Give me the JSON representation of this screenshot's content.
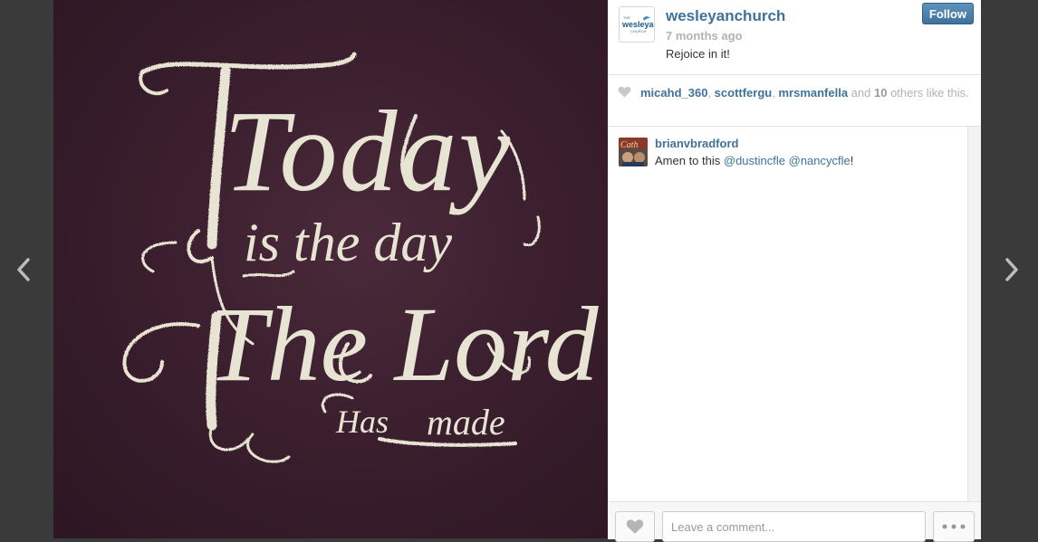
{
  "navigation": {
    "prev_icon": "chevron-left-icon",
    "next_icon": "chevron-right-icon"
  },
  "photo": {
    "lines": [
      "Today",
      "is the day",
      "The Lord",
      "Has",
      "made"
    ],
    "background_color": "#3b1f2e",
    "chalk_color": "#e8e4d4"
  },
  "post": {
    "owner_avatar_text": "wesleyan",
    "owner_avatar_small_top": "THE",
    "owner_avatar_small_bottom": "CHURCH",
    "owner": "wesleyanchurch",
    "time": "7 months ago",
    "caption": "Rejoice in it!",
    "follow_label": "Follow"
  },
  "likes": {
    "users": [
      "micahd_360",
      "scottfergu",
      "mrsmanfella"
    ],
    "sep1": ", ",
    "sep2": ", ",
    "and": " and ",
    "count": "10",
    "suffix": " others like this."
  },
  "comments": [
    {
      "user": "brianvbradford",
      "text_prefix": "Amen to this ",
      "mention1": "@dustincfle",
      "space": " ",
      "mention2": "@nancycfle",
      "text_suffix": "!"
    }
  ],
  "footer": {
    "comment_placeholder": "Leave a comment...",
    "like_icon": "heart-icon",
    "more_icon": "more-dots-icon"
  },
  "colors": {
    "link": "#3f729b",
    "muted": "#b2b2b2",
    "follow_button": "#3f729b"
  }
}
